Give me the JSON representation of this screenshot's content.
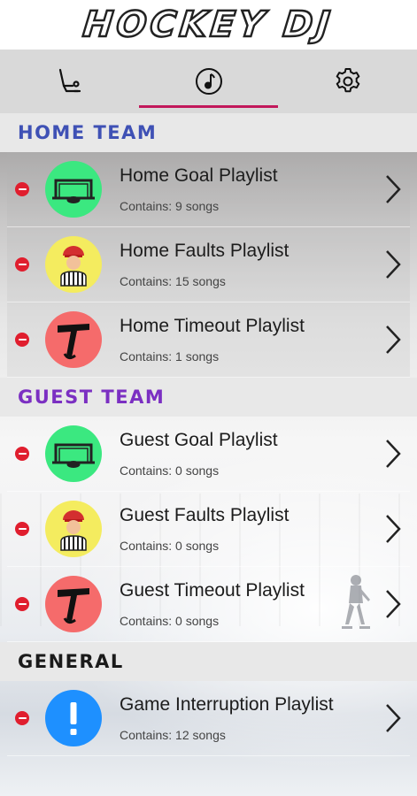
{
  "app": {
    "title": "Hockey DJ"
  },
  "tabs": [
    {
      "name": "teams-tab",
      "icon": "referee-chair-icon",
      "active": false
    },
    {
      "name": "music-tab",
      "icon": "music-note-icon",
      "active": true
    },
    {
      "name": "settings-tab",
      "icon": "gear-icon",
      "active": false
    }
  ],
  "sections": {
    "home": {
      "header": "Home Team",
      "rows": [
        {
          "title": "Home Goal Playlist",
          "subtitle": "Contains: 9 songs",
          "icon": "goal-net-icon",
          "color": "#3be880"
        },
        {
          "title": "Home Faults Playlist",
          "subtitle": "Contains: 15 songs",
          "icon": "referee-icon",
          "color": "#f4ec5f"
        },
        {
          "title": "Home Timeout Playlist",
          "subtitle": "Contains: 1 songs",
          "icon": "timeout-icon",
          "color": "#f56b6b"
        }
      ]
    },
    "guest": {
      "header": "Guest Team",
      "rows": [
        {
          "title": "Guest Goal Playlist",
          "subtitle": "Contains: 0 songs",
          "icon": "goal-net-icon",
          "color": "#3be880"
        },
        {
          "title": "Guest Faults Playlist",
          "subtitle": "Contains: 0 songs",
          "icon": "referee-icon",
          "color": "#f4ec5f"
        },
        {
          "title": "Guest Timeout Playlist",
          "subtitle": "Contains: 0 songs",
          "icon": "timeout-icon",
          "color": "#f56b6b"
        }
      ]
    },
    "general": {
      "header": "General",
      "rows": [
        {
          "title": "Game Interruption Playlist",
          "subtitle": "Contains: 12 songs",
          "icon": "exclamation-icon",
          "color": "#1e90ff"
        }
      ]
    }
  },
  "colors": {
    "accent": "#c2185b",
    "home": "#3f51b5",
    "guest": "#7b2fc2",
    "remove": "#e01e2e"
  }
}
